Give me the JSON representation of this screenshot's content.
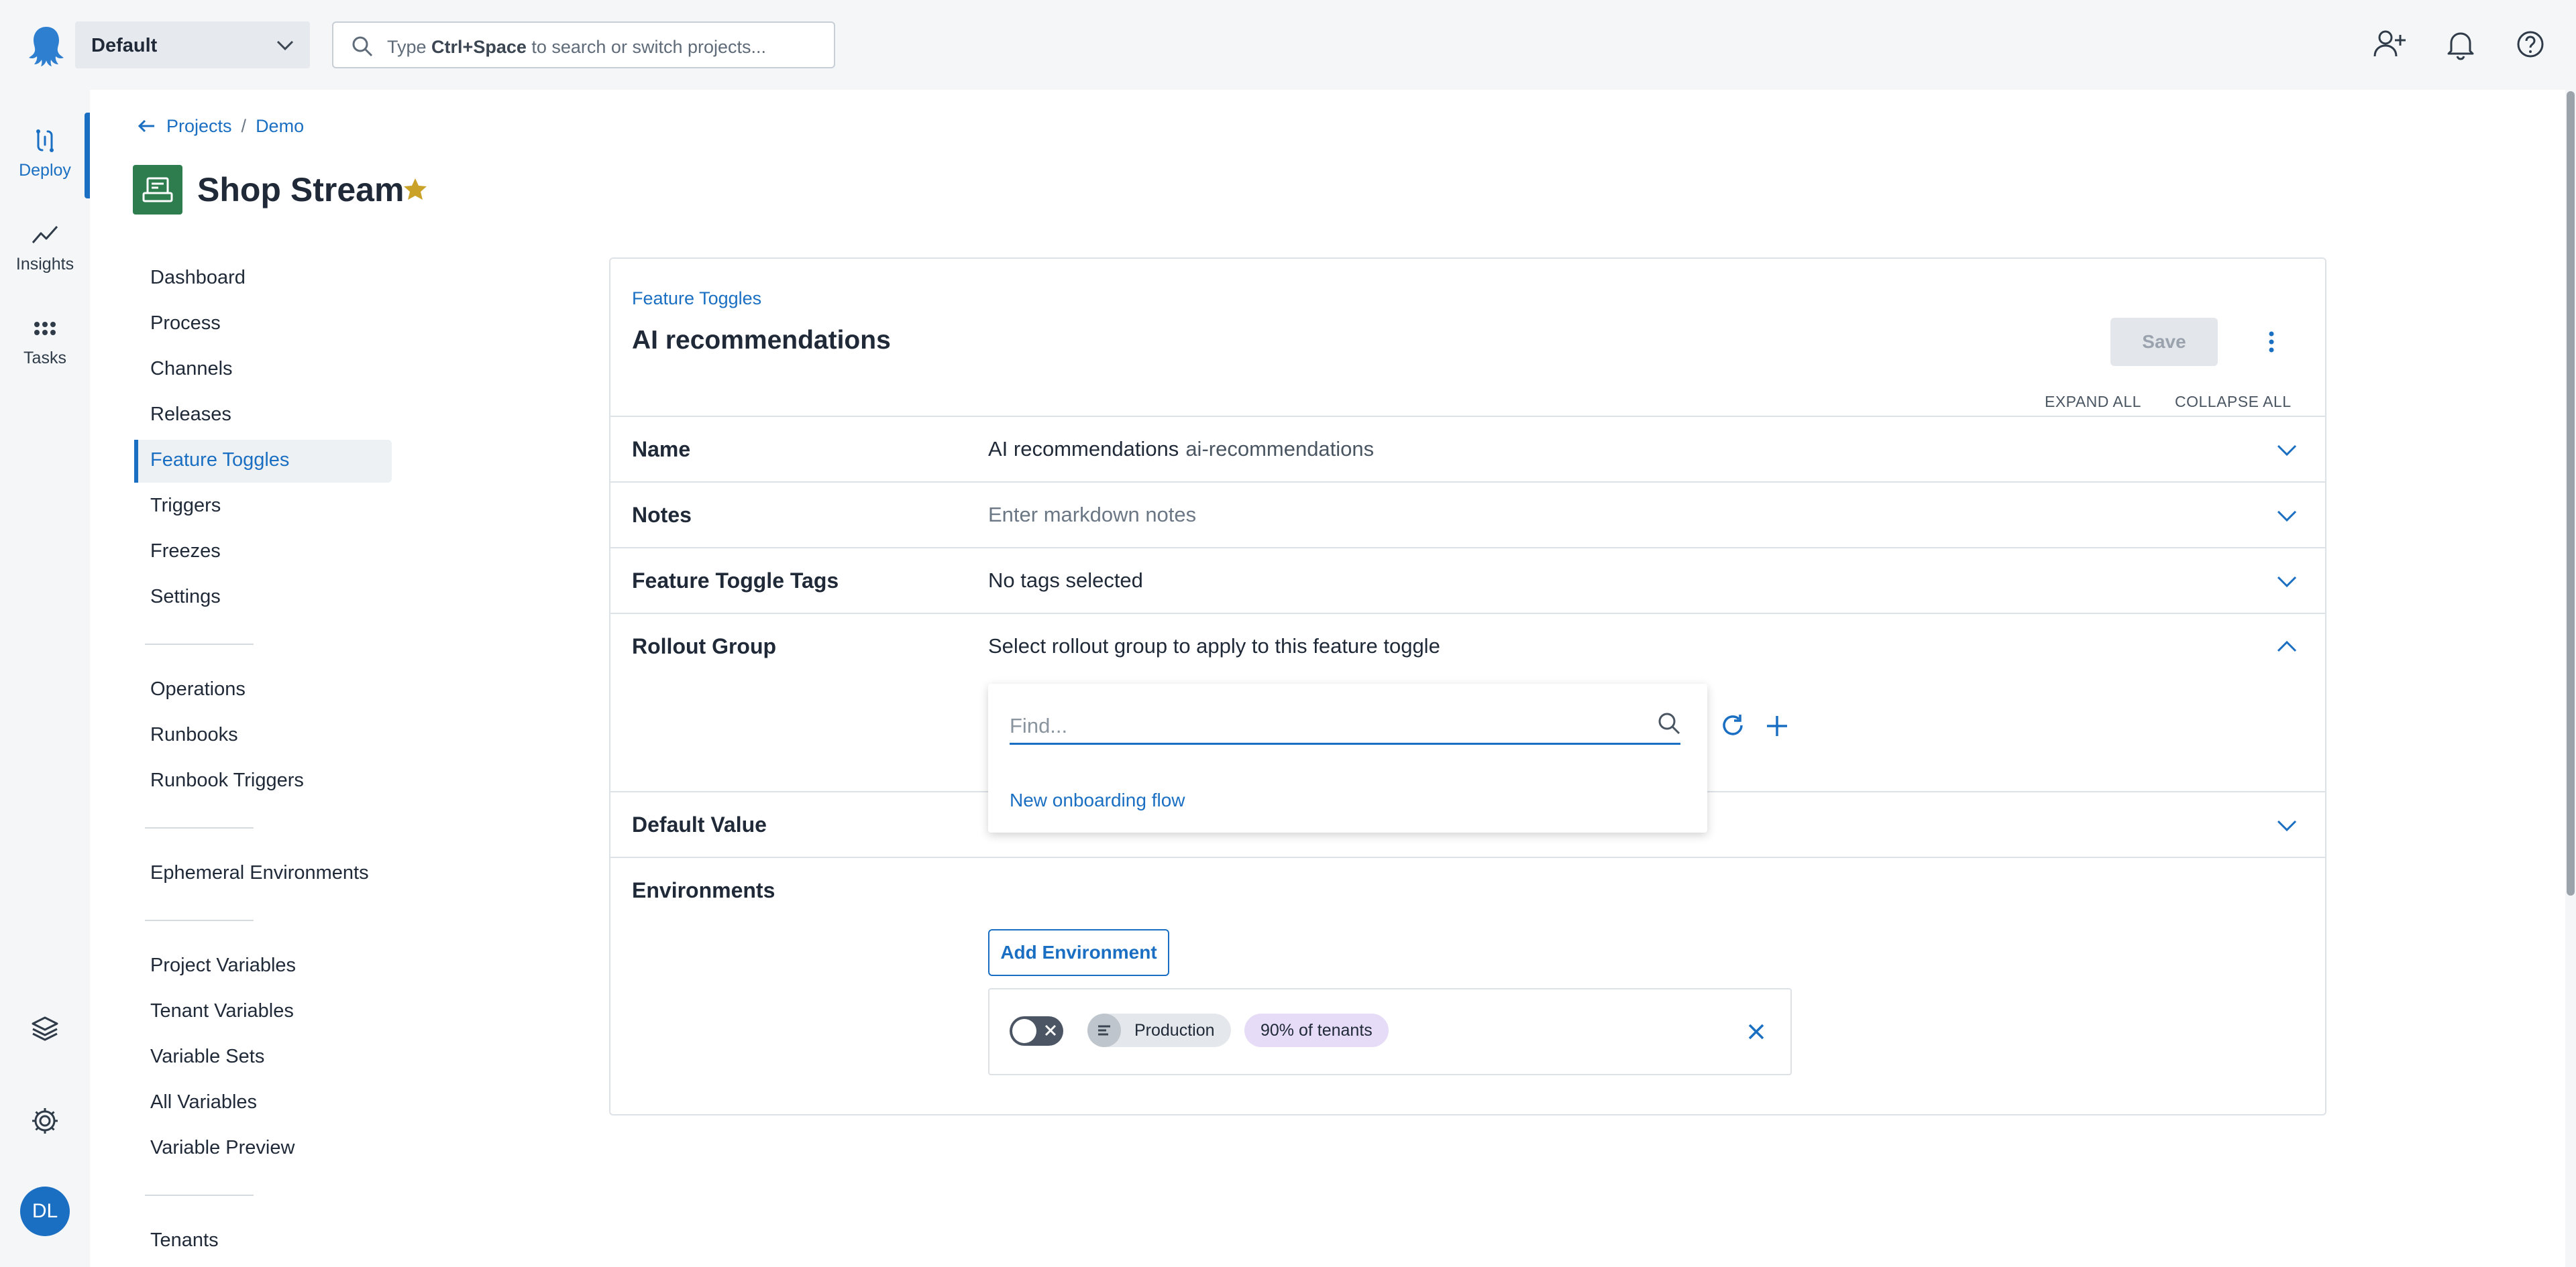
{
  "topbar": {
    "space_name": "Default",
    "search_prefix": "Type ",
    "search_shortcut": "Ctrl+Space",
    "search_suffix": " to search or switch projects..."
  },
  "rail": {
    "items": [
      {
        "label": "Deploy",
        "icon": "deploy-icon",
        "active": true
      },
      {
        "label": "Insights",
        "icon": "insights-icon"
      },
      {
        "label": "Tasks",
        "icon": "tasks-icon"
      }
    ],
    "bottom_icons": [
      "layers-icon",
      "gear-icon"
    ],
    "avatar_initials": "DL"
  },
  "breadcrumb": {
    "projects": "Projects",
    "separator": "/",
    "current": "Demo"
  },
  "project": {
    "title": "Shop Stream",
    "favorite": true
  },
  "project_nav": {
    "items": [
      "Dashboard",
      "Process",
      "Channels",
      "Releases",
      "Feature Toggles",
      "Triggers",
      "Freezes",
      "Settings",
      "Operations",
      "Runbooks",
      "Runbook Triggers",
      "Ephemeral Environments",
      "Project Variables",
      "Tenant Variables",
      "Variable Sets",
      "All Variables",
      "Variable Preview",
      "Tenants"
    ],
    "active": "Feature Toggles"
  },
  "panel": {
    "crumb": "Feature Toggles",
    "title": "AI recommendations",
    "save_label": "Save",
    "expand_all": "EXPAND ALL",
    "collapse_all": "COLLAPSE ALL",
    "rows": {
      "name": {
        "label": "Name",
        "value": "AI recommendations",
        "slug": "ai-recommendations"
      },
      "notes": {
        "label": "Notes",
        "value": "Enter markdown notes"
      },
      "tags": {
        "label": "Feature Toggle Tags",
        "value": "No tags selected"
      },
      "rollout": {
        "label": "Rollout Group",
        "value": "Select rollout group to apply to this feature toggle"
      },
      "default_value": {
        "label": "Default Value"
      },
      "environments": {
        "label": "Environments"
      }
    },
    "rollout_dropdown": {
      "placeholder": "Find...",
      "options": [
        "New onboarding flow"
      ]
    },
    "environments": {
      "add_label": "Add Environment",
      "entries": [
        {
          "name": "Production",
          "tenants": "90% of tenants",
          "enabled": false
        }
      ]
    }
  },
  "colors": {
    "accent": "#1a6fc2",
    "project_icon_bg": "#2e7d4f",
    "star": "#c9a227",
    "tenant_chip": "#e6dcf7"
  }
}
